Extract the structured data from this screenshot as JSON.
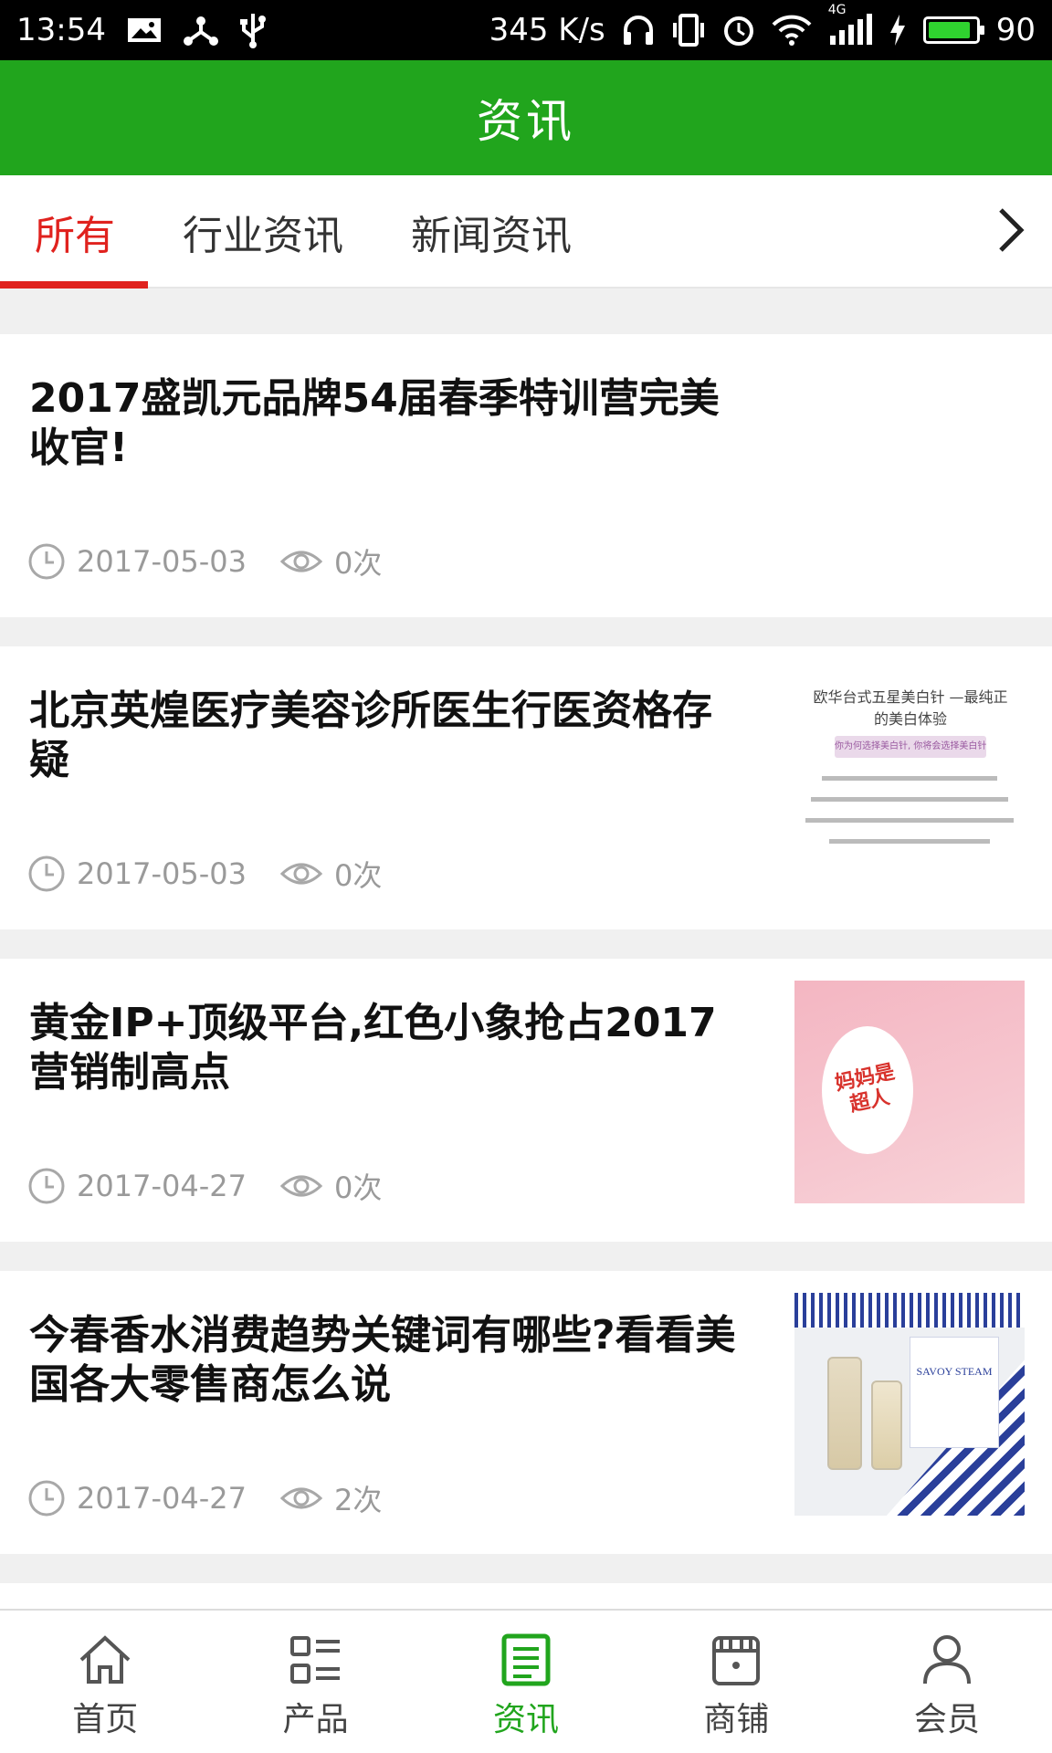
{
  "status_bar": {
    "time": "13:54",
    "speed": "345 K/s",
    "network": "4G",
    "battery": "90",
    "battery_level": 0.9
  },
  "app_bar": {
    "title": "资讯"
  },
  "tabs": [
    {
      "label": "所有",
      "active": true
    },
    {
      "label": "行业资讯",
      "active": false
    },
    {
      "label": "新闻资讯",
      "active": false
    }
  ],
  "articles": [
    {
      "title": "2017盛凯元品牌54届春季特训营完美收官!",
      "date": "2017-05-03",
      "views": "0次",
      "thumbnail": "none"
    },
    {
      "title": "北京英煌医疗美容诊所医生行医资格存疑",
      "date": "2017-05-03",
      "views": "0次",
      "thumbnail": "text-document",
      "thumbnail_text": {
        "heading": "欧华台式五星美白针 —最纯正的美白体验",
        "pill": "你为何选择美白针, 你将会选择美白针"
      }
    },
    {
      "title": "黄金IP+顶级平台,红色小象抢占2017营销制高点",
      "date": "2017-04-27",
      "views": "0次",
      "thumbnail": "pink-promo",
      "thumbnail_text": {
        "badge": "妈妈是超人"
      }
    },
    {
      "title": "今春香水消费趋势关键词有哪些?看看美国各大零售商怎么说",
      "date": "2017-04-27",
      "views": "2次",
      "thumbnail": "perfume-ad",
      "thumbnail_text": {
        "brand": "SAVOY STEAM"
      }
    }
  ],
  "bottom_nav": [
    {
      "label": "首页",
      "icon": "home-icon",
      "active": false
    },
    {
      "label": "产品",
      "icon": "grid-list-icon",
      "active": false
    },
    {
      "label": "资讯",
      "icon": "news-icon",
      "active": true
    },
    {
      "label": "商铺",
      "icon": "shop-icon",
      "active": false
    },
    {
      "label": "会员",
      "icon": "user-icon",
      "active": false
    }
  ],
  "colors": {
    "primary_green": "#21a51d",
    "accent_red": "#e0221e",
    "meta_gray": "#9a9a9a"
  }
}
